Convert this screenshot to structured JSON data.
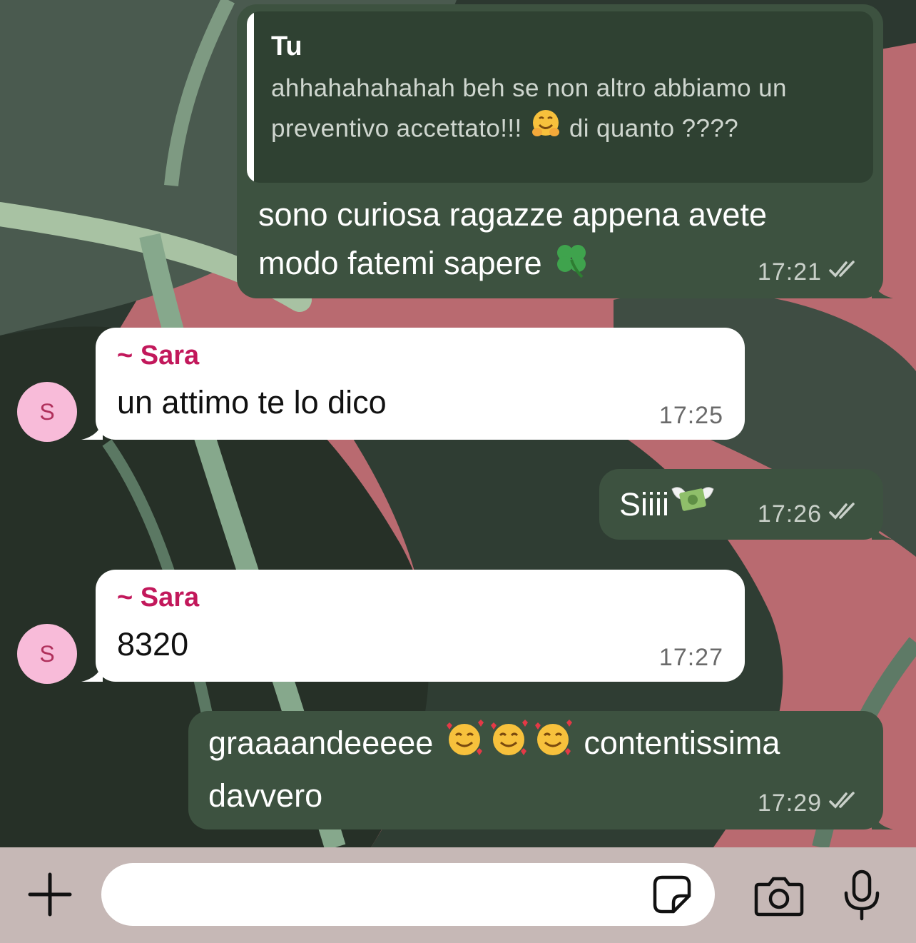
{
  "messages": [
    {
      "direction": "out",
      "quote": {
        "author": "Tu",
        "line1": "ahhahahahahah beh se non altro abbiamo un",
        "line2_a": "preventivo accettato!!! ",
        "line2_b": " di quanto ????"
      },
      "line1": "sono curiosa ragazze appena avete",
      "line2": "modo fatemi sapere ",
      "time": "17:21",
      "status": "read"
    },
    {
      "direction": "in",
      "sender": "~ Sara",
      "avatar": "S",
      "text": "un attimo te lo dico",
      "time": "17:25"
    },
    {
      "direction": "out",
      "text": "Siiii",
      "emoji": "money-with-wings",
      "time": "17:26",
      "status": "read"
    },
    {
      "direction": "in",
      "sender": "~ Sara",
      "avatar": "S",
      "text": "8320",
      "time": "17:27"
    },
    {
      "direction": "out",
      "line1_a": "graaaandeeeee ",
      "line1_b": " contentissima",
      "line2": "davvero",
      "emojis": [
        "smiling-face-with-hearts",
        "smiling-face-with-hearts",
        "smiling-face-with-hearts"
      ],
      "time": "17:29",
      "status": "read"
    }
  ],
  "composer": {
    "input_value": "",
    "icons": [
      "plus-icon",
      "sticker-icon",
      "camera-icon",
      "microphone-icon"
    ]
  },
  "colors": {
    "outgoing_bubble": "#3d5240",
    "incoming_bubble": "#ffffff",
    "sender_name": "#c2185b",
    "avatar_bg": "#f8bbd9",
    "composer_bar": "#c6b8b6"
  }
}
